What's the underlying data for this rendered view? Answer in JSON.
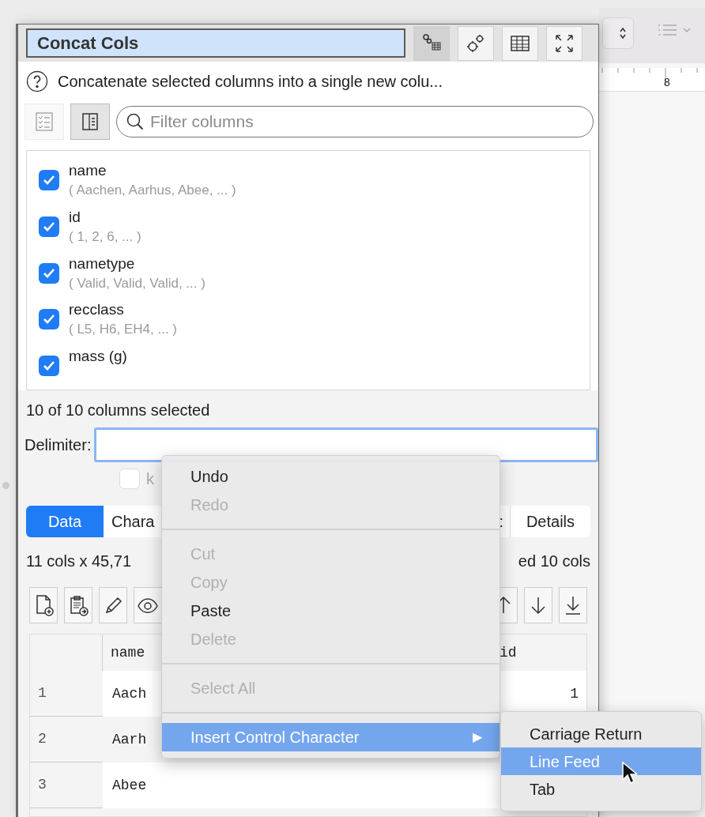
{
  "title_field": "Concat Cols",
  "description": "Concatenate selected columns into a single new colu...",
  "view_buttons": [
    {
      "selected": false
    },
    {
      "selected": true
    }
  ],
  "filter": {
    "placeholder": "Filter columns"
  },
  "columns": [
    {
      "name": "name",
      "preview": "( Aachen, Aarhus, Abee, ... )",
      "checked": true
    },
    {
      "name": "id",
      "preview": "( 1, 2, 6, ... )",
      "checked": true
    },
    {
      "name": "nametype",
      "preview": "( Valid, Valid, Valid, ... )",
      "checked": true
    },
    {
      "name": "recclass",
      "preview": "( L5, H6, EH4, ... )",
      "checked": true
    },
    {
      "name": "mass (g)",
      "checked": true
    }
  ],
  "selection_summary": "10 of 10 columns selected",
  "delimiter": {
    "label": "Delimiter:"
  },
  "option_checkbox": {
    "label": "k",
    "checked": false
  },
  "tabs": [
    {
      "label": "Data",
      "selected": true
    },
    {
      "label": "Chara",
      "selected": false
    },
    {
      "label": ":",
      "selected": false
    },
    {
      "label": "Details",
      "selected": false
    }
  ],
  "table_info": {
    "left": "11 cols x 45,71",
    "right": "ed 10 cols"
  },
  "table": {
    "columns": [
      "name",
      "id"
    ],
    "rows": [
      {
        "index": "1",
        "cells": [
          "Aach",
          "1"
        ]
      },
      {
        "index": "2",
        "cells": [
          "Aarh"
        ]
      },
      {
        "index": "3",
        "cells": [
          "Abee"
        ]
      }
    ]
  },
  "context_menu": {
    "items": [
      {
        "kind": "item",
        "label": "Undo",
        "disabled": false
      },
      {
        "kind": "item",
        "label": "Redo",
        "disabled": true
      },
      {
        "kind": "separator"
      },
      {
        "kind": "item",
        "label": "Cut",
        "disabled": true
      },
      {
        "kind": "item",
        "label": "Copy",
        "disabled": true
      },
      {
        "kind": "item",
        "label": "Paste",
        "disabled": false
      },
      {
        "kind": "item",
        "label": "Delete",
        "disabled": true
      },
      {
        "kind": "separator"
      },
      {
        "kind": "item",
        "label": "Select All",
        "disabled": true
      },
      {
        "kind": "separator"
      },
      {
        "kind": "submenu",
        "label": "Insert Control Character",
        "arrow": "▶",
        "selected": true
      }
    ]
  },
  "submenu": {
    "items": [
      {
        "label": "Carriage Return",
        "selected": false
      },
      {
        "label": "Line Feed",
        "selected": true
      },
      {
        "label": "Tab",
        "selected": false
      }
    ]
  },
  "ruler": {
    "label": "8"
  }
}
